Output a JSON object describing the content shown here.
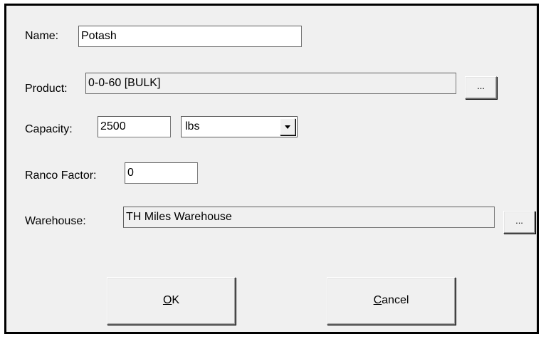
{
  "form": {
    "name": {
      "label": "Name:",
      "value": "Potash"
    },
    "product": {
      "label": "Product:",
      "value": "0-0-60 [BULK]",
      "browse_label": "..."
    },
    "capacity": {
      "label": "Capacity:",
      "value": "2500",
      "unit_selected": "lbs",
      "dropdown_icon": "chevron-down-icon"
    },
    "ranco_factor": {
      "label": "Ranco Factor:",
      "value": "0"
    },
    "warehouse": {
      "label": "Warehouse:",
      "value": "TH Miles Warehouse",
      "browse_label": "..."
    }
  },
  "buttons": {
    "ok": {
      "accel": "O",
      "rest": "K"
    },
    "cancel": {
      "accel": "C",
      "rest": "ancel"
    }
  },
  "colors": {
    "dialog_background": "#f0f0f0",
    "field_background": "#ffffff",
    "border": "#000000"
  }
}
